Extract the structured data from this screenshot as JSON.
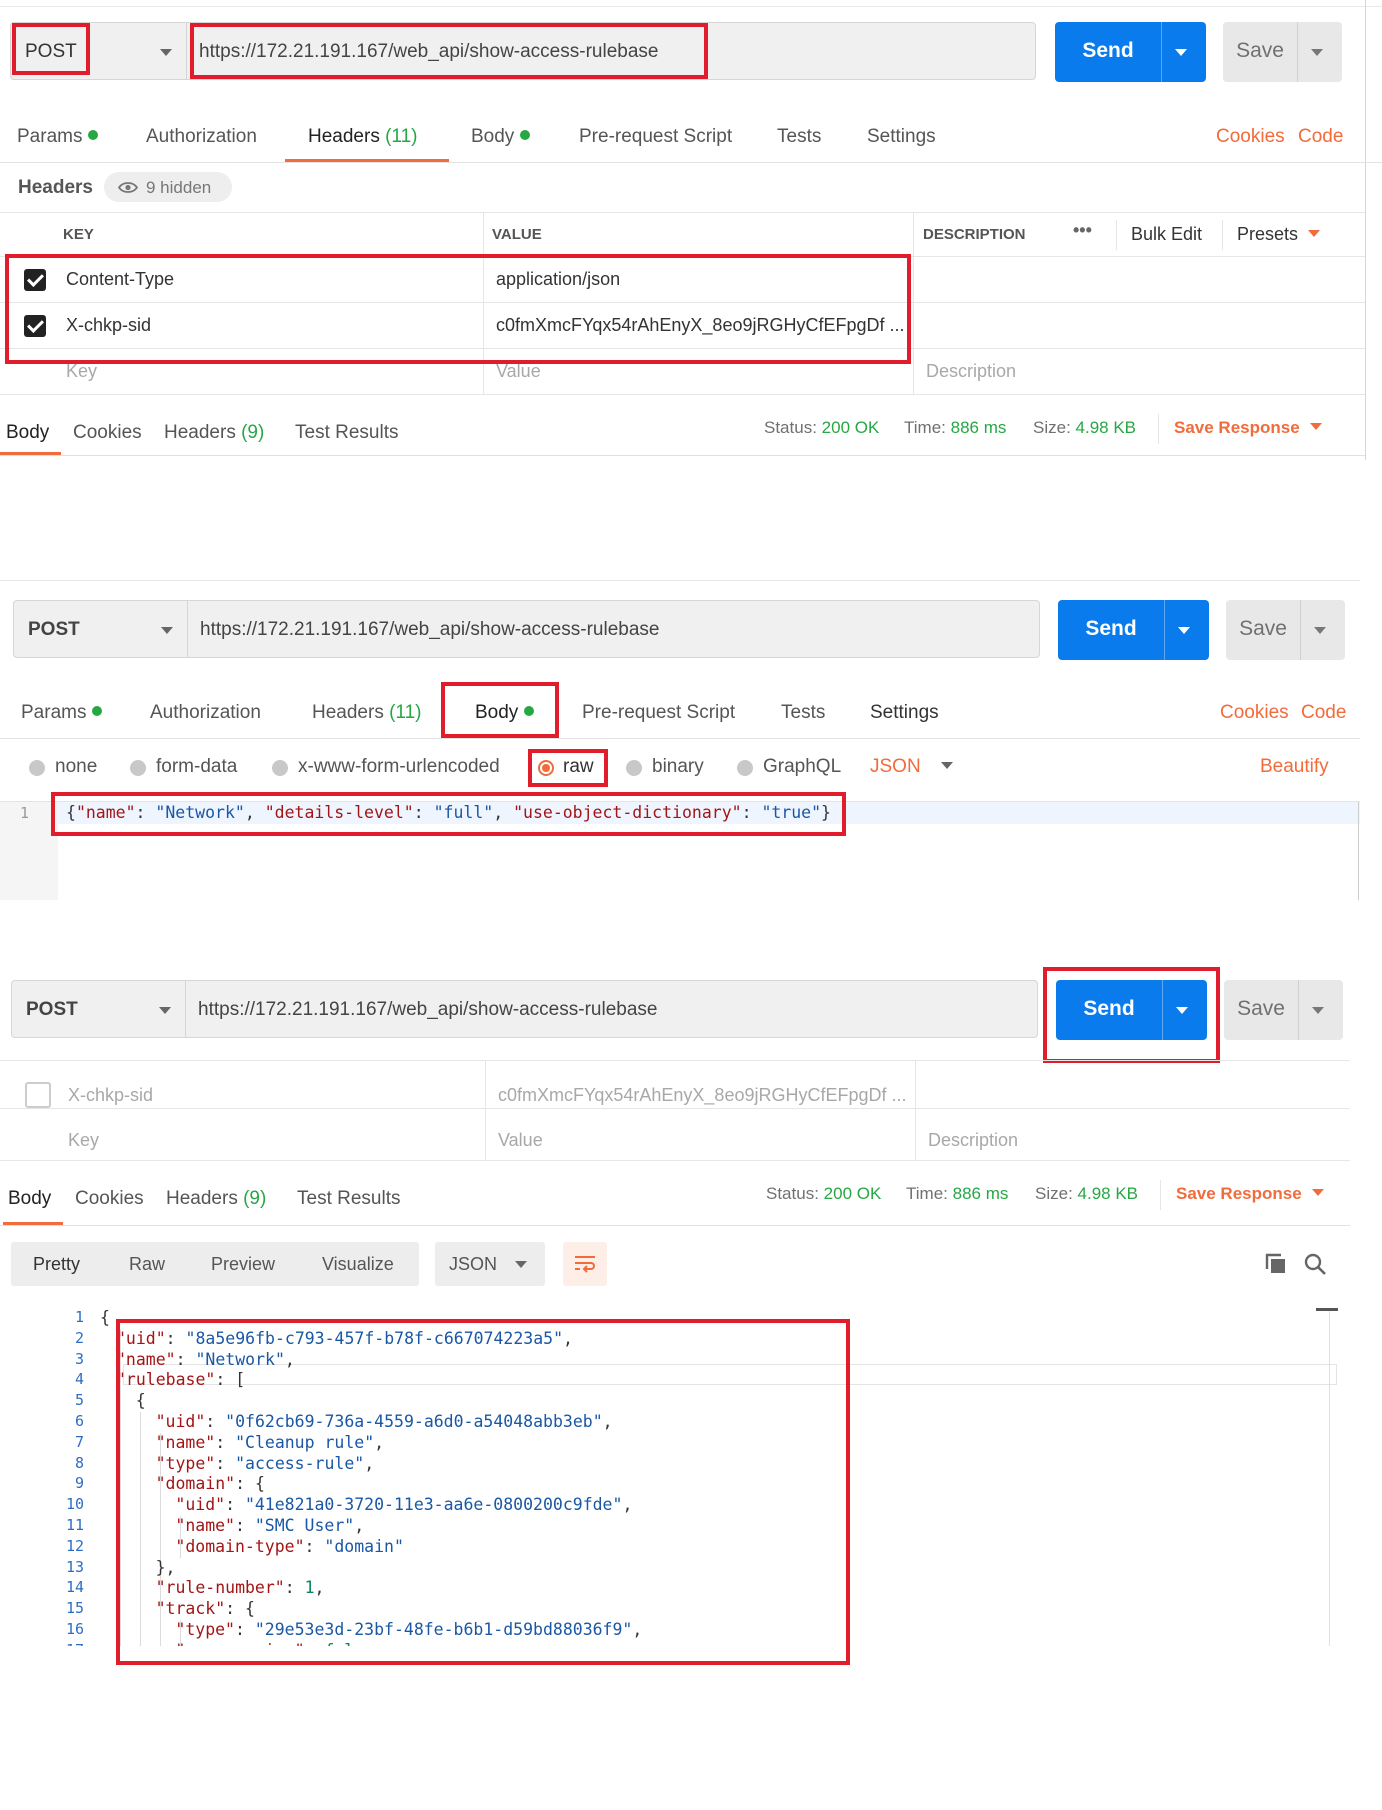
{
  "shared": {
    "method": "POST",
    "url": "https://172.21.191.167/web_api/show-access-rulebase",
    "send_label": "Send",
    "save_label": "Save"
  },
  "request_tabs": {
    "params": "Params",
    "authorization": "Authorization",
    "headers": "Headers",
    "headers_count": "(11)",
    "body": "Body",
    "pre_request": "Pre-request Script",
    "tests": "Tests",
    "settings": "Settings",
    "cookies": "Cookies",
    "code": "Code"
  },
  "panel1": {
    "headers_title": "Headers",
    "hidden_badge": "9 hidden",
    "columns": {
      "key": "KEY",
      "value": "VALUE",
      "description": "DESCRIPTION"
    },
    "more_label": "•••",
    "bulk_edit": "Bulk Edit",
    "presets": "Presets",
    "rows": [
      {
        "key": "Content-Type",
        "value": "application/json",
        "checked": true
      },
      {
        "key": "X-chkp-sid",
        "value": "c0fmXmcFYqx54rAhEnyX_8eo9jRGHyCfEFpgDf ...",
        "checked": true
      }
    ],
    "placeholder_key": "Key",
    "placeholder_value": "Value",
    "placeholder_desc": "Description"
  },
  "response_bar": {
    "body": "Body",
    "cookies": "Cookies",
    "headers": "Headers",
    "headers_count": "(9)",
    "test_results": "Test Results",
    "status_label": "Status:",
    "status_value": "200 OK",
    "time_label": "Time:",
    "time_value": "886 ms",
    "size_label": "Size:",
    "size_value": "4.98 KB",
    "save_response": "Save Response"
  },
  "panel2": {
    "body_modes": [
      "none",
      "form-data",
      "x-www-form-urlencoded",
      "raw",
      "binary",
      "GraphQL"
    ],
    "selected_mode": "raw",
    "format": "JSON",
    "beautify": "Beautify",
    "line_number": "1",
    "body_parts": {
      "open": "{",
      "k1": "\"name\"",
      "v1": "\"Network\"",
      "k2": "\"details-level\"",
      "v2": "\"full\"",
      "k3": "\"use-object-dictionary\"",
      "v3": "\"true\"",
      "close": "}"
    }
  },
  "panel3": {
    "row_key": "X-chkp-sid",
    "row_value": "c0fmXmcFYqx54rAhEnyX_8eo9jRGHyCfEFpgDf ...",
    "placeholder_key": "Key",
    "placeholder_value": "Value",
    "placeholder_desc": "Description",
    "views": [
      "Pretty",
      "Raw",
      "Preview",
      "Visualize"
    ],
    "format": "JSON",
    "json_lines": [
      {
        "n": "1",
        "t": [
          [
            "p",
            "{"
          ]
        ],
        "indent": 0
      },
      {
        "n": "2",
        "t": [
          [
            "k",
            "\"uid\""
          ],
          [
            "p",
            ": "
          ],
          [
            "s",
            "\"8a5e96fb-c793-457f-b78f-c667074223a5\""
          ],
          [
            "p",
            ","
          ]
        ],
        "indent": 1
      },
      {
        "n": "3",
        "t": [
          [
            "k",
            "\"name\""
          ],
          [
            "p",
            ": "
          ],
          [
            "s",
            "\"Network\""
          ],
          [
            "p",
            ","
          ]
        ],
        "indent": 1
      },
      {
        "n": "4",
        "t": [
          [
            "k",
            "\"rulebase\""
          ],
          [
            "p",
            ": ["
          ]
        ],
        "indent": 1
      },
      {
        "n": "5",
        "t": [
          [
            "p",
            "{"
          ]
        ],
        "indent": 2
      },
      {
        "n": "6",
        "t": [
          [
            "k",
            "\"uid\""
          ],
          [
            "p",
            ": "
          ],
          [
            "s",
            "\"0f62cb69-736a-4559-a6d0-a54048abb3eb\""
          ],
          [
            "p",
            ","
          ]
        ],
        "indent": 3
      },
      {
        "n": "7",
        "t": [
          [
            "k",
            "\"name\""
          ],
          [
            "p",
            ": "
          ],
          [
            "s",
            "\"Cleanup rule\""
          ],
          [
            "p",
            ","
          ]
        ],
        "indent": 3
      },
      {
        "n": "8",
        "t": [
          [
            "k",
            "\"type\""
          ],
          [
            "p",
            ": "
          ],
          [
            "s",
            "\"access-rule\""
          ],
          [
            "p",
            ","
          ]
        ],
        "indent": 3
      },
      {
        "n": "9",
        "t": [
          [
            "k",
            "\"domain\""
          ],
          [
            "p",
            ": {"
          ]
        ],
        "indent": 3
      },
      {
        "n": "10",
        "t": [
          [
            "k",
            "\"uid\""
          ],
          [
            "p",
            ": "
          ],
          [
            "s",
            "\"41e821a0-3720-11e3-aa6e-0800200c9fde\""
          ],
          [
            "p",
            ","
          ]
        ],
        "indent": 4
      },
      {
        "n": "11",
        "t": [
          [
            "k",
            "\"name\""
          ],
          [
            "p",
            ": "
          ],
          [
            "s",
            "\"SMC User\""
          ],
          [
            "p",
            ","
          ]
        ],
        "indent": 4
      },
      {
        "n": "12",
        "t": [
          [
            "k",
            "\"domain-type\""
          ],
          [
            "p",
            ": "
          ],
          [
            "s",
            "\"domain\""
          ]
        ],
        "indent": 4
      },
      {
        "n": "13",
        "t": [
          [
            "p",
            "},"
          ]
        ],
        "indent": 3
      },
      {
        "n": "14",
        "t": [
          [
            "k",
            "\"rule-number\""
          ],
          [
            "p",
            ": "
          ],
          [
            "n",
            "1"
          ],
          [
            "p",
            ","
          ]
        ],
        "indent": 3
      },
      {
        "n": "15",
        "t": [
          [
            "k",
            "\"track\""
          ],
          [
            "p",
            ": {"
          ]
        ],
        "indent": 3
      },
      {
        "n": "16",
        "t": [
          [
            "k",
            "\"type\""
          ],
          [
            "p",
            ": "
          ],
          [
            "s",
            "\"29e53e3d-23bf-48fe-b6b1-d59bd88036f9\""
          ],
          [
            "p",
            ","
          ]
        ],
        "indent": 4
      },
      {
        "n": "17",
        "t": [
          [
            "k",
            "\"per-session\""
          ],
          [
            "p",
            ": "
          ],
          [
            "n",
            "false"
          ]
        ],
        "indent": 4
      }
    ]
  },
  "colors": {
    "accent": "#f26b3a",
    "send_blue": "#097bed",
    "success_green": "#27a744",
    "highlight_red": "#e01e2b"
  },
  "icons": [
    "eye-icon",
    "copy-icon",
    "search-icon",
    "wrap-lines-icon",
    "chevron-down-icon",
    "checkbox-icon"
  ]
}
